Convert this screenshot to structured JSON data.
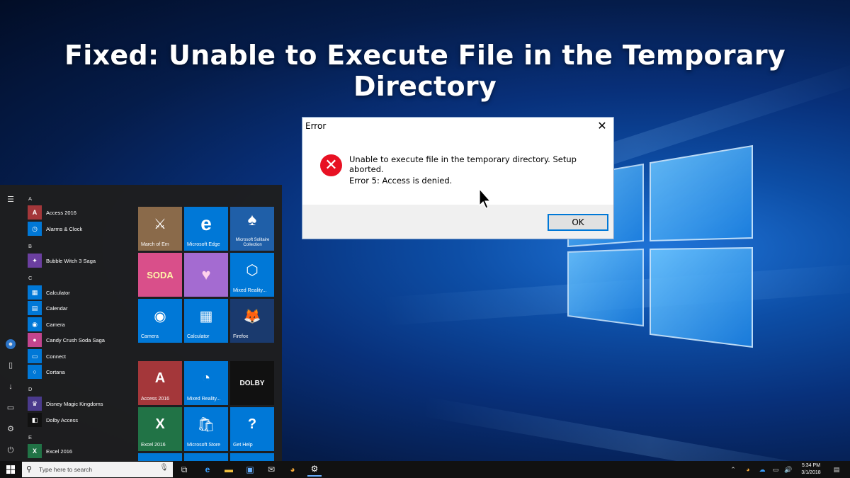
{
  "headline": "Fixed: Unable to Execute File in the Temporary Directory",
  "dialog": {
    "title": "Error",
    "close_glyph": "✕",
    "icon": "error-icon",
    "message": "Unable to execute file in the temporary directory. Setup aborted.",
    "detail": "Error 5: Access is denied.",
    "ok_label": "OK"
  },
  "start_menu": {
    "groups": [
      {
        "letter": "A",
        "apps": [
          {
            "label": "Access 2016",
            "icon": "access-icon",
            "color": "#a4373a",
            "glyph": "A"
          },
          {
            "label": "Alarms & Clock",
            "icon": "alarm-clock-icon",
            "color": "#0078d7",
            "glyph": "◷"
          }
        ]
      },
      {
        "letter": "B",
        "apps": [
          {
            "label": "Bubble Witch 3 Saga",
            "icon": "bubble-witch-icon",
            "color": "#6b3fa0",
            "glyph": "✦"
          }
        ]
      },
      {
        "letter": "C",
        "apps": [
          {
            "label": "Calculator",
            "icon": "calculator-icon",
            "color": "#0078d7",
            "glyph": "▦"
          },
          {
            "label": "Calendar",
            "icon": "calendar-icon",
            "color": "#0078d7",
            "glyph": "▤"
          },
          {
            "label": "Camera",
            "icon": "camera-icon",
            "color": "#0078d7",
            "glyph": "◉"
          },
          {
            "label": "Candy Crush Soda Saga",
            "icon": "candy-crush-icon",
            "color": "#c2458e",
            "glyph": "●"
          },
          {
            "label": "Connect",
            "icon": "connect-icon",
            "color": "#0078d7",
            "glyph": "▭"
          },
          {
            "label": "Cortana",
            "icon": "cortana-icon",
            "color": "#0078d7",
            "glyph": "○"
          }
        ]
      },
      {
        "letter": "D",
        "apps": [
          {
            "label": "Disney Magic Kingdoms",
            "icon": "disney-icon",
            "color": "#4a3a8c",
            "glyph": "♛"
          },
          {
            "label": "Dolby Access",
            "icon": "dolby-icon",
            "color": "#111111",
            "glyph": "◧"
          }
        ]
      },
      {
        "letter": "E",
        "apps": [
          {
            "label": "Excel 2016",
            "icon": "excel-icon",
            "color": "#217346",
            "glyph": "X"
          }
        ]
      }
    ],
    "tiles": [
      {
        "label": "March of Em",
        "icon": "march-of-empires-icon",
        "color": "#8a6a4a",
        "glyph": "⚔"
      },
      {
        "label": "Microsoft Edge",
        "icon": "edge-icon",
        "color": "#0078d7",
        "glyph": "e"
      },
      {
        "label": "Microsoft Solitaire Collection",
        "icon": "solitaire-icon",
        "color": "#1f5fa8",
        "glyph": "♠"
      },
      {
        "label": "",
        "icon": "candy-crush-soda-tile-icon",
        "color": "#d94f8a",
        "glyph": "SODA"
      },
      {
        "label": "",
        "icon": "disney-tile-icon",
        "color": "#a46bd1",
        "glyph": "♥"
      },
      {
        "label": "Mixed Reality...",
        "icon": "mixed-reality-icon",
        "color": "#0078d7",
        "glyph": "⬡"
      },
      {
        "label": "Camera",
        "icon": "camera-tile-icon",
        "color": "#0078d7",
        "glyph": "◉"
      },
      {
        "label": "Calculator",
        "icon": "calculator-tile-icon",
        "color": "#0078d7",
        "glyph": "▦"
      },
      {
        "label": "Firefox",
        "icon": "firefox-icon",
        "color": "#1a3a6e",
        "glyph": "🦊"
      },
      {
        "label": "Access 2016",
        "icon": "access-tile-icon",
        "color": "#a4373a",
        "glyph": "A"
      },
      {
        "label": "Mixed Reality...",
        "icon": "mixed-reality-portal-icon",
        "color": "#0078d7",
        "glyph": "◔"
      },
      {
        "label": "",
        "icon": "dolby-tile-icon",
        "color": "#111111",
        "glyph": "DOLBY"
      },
      {
        "label": "Excel 2016",
        "icon": "excel-tile-icon",
        "color": "#217346",
        "glyph": "X"
      },
      {
        "label": "Microsoft Store",
        "icon": "store-icon",
        "color": "#0078d7",
        "glyph": "🛍"
      },
      {
        "label": "Get Help",
        "icon": "get-help-icon",
        "color": "#0078d7",
        "glyph": "?"
      }
    ]
  },
  "taskbar": {
    "search_placeholder": "Type here to search",
    "clock_time": "5:34 PM",
    "clock_date": "3/1/2018"
  }
}
